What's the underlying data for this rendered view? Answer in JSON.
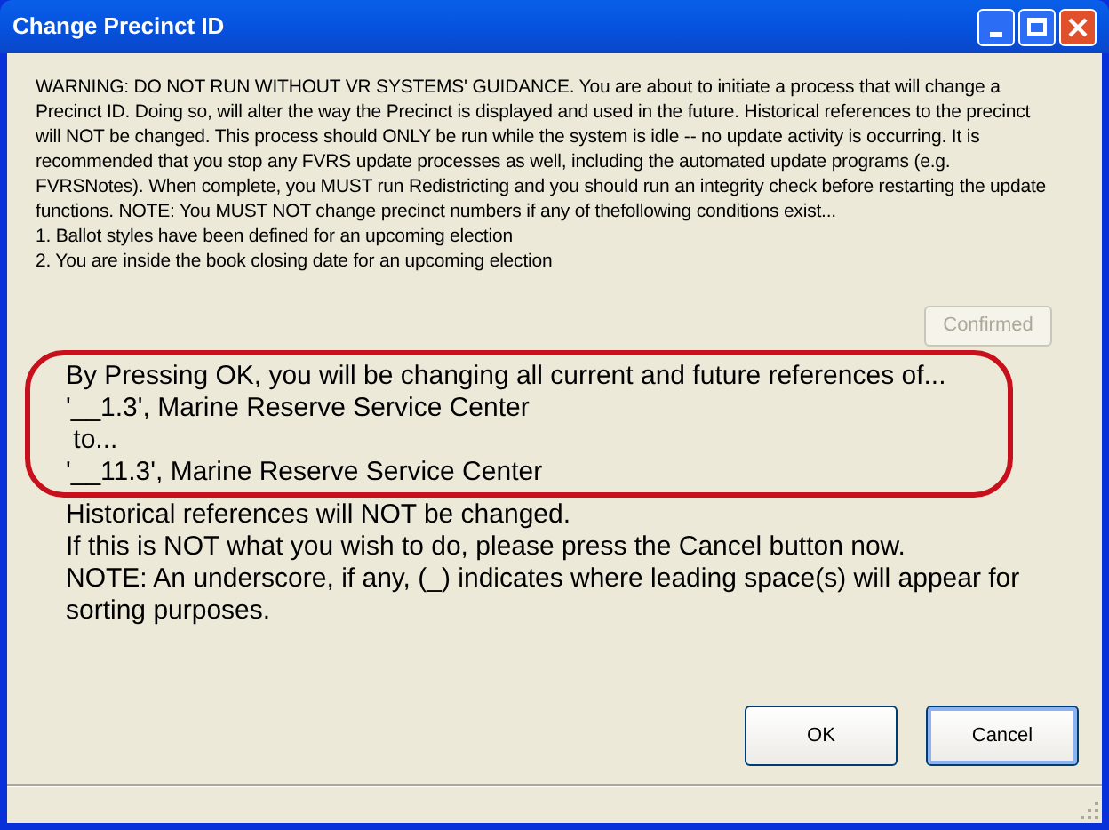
{
  "window": {
    "title": "Change Precinct ID"
  },
  "warning": {
    "paragraph": "WARNING:  DO NOT RUN WITHOUT VR SYSTEMS' GUIDANCE. You are about to initiate a process that will change a Precinct ID.  Doing so, will alter the way the Precinct is displayed and used in the future.  Historical references to the precinct will NOT be changed.  This process should ONLY be run while the system is idle -- no update activity is occurring.  It is recommended that you stop any FVRS update processes as well, including the automated update programs (e.g. FVRSNotes).  When complete, you MUST run Redistricting and you should run an integrity check before restarting the update functions.  NOTE: You MUST NOT change precinct numbers if any of thefollowing conditions exist...",
    "conditions": [
      "1. Ballot styles have been defined for an upcoming election",
      "2. You are inside the book closing date for an upcoming election"
    ]
  },
  "confirmed_button": {
    "label": "Confirmed",
    "disabled": true
  },
  "highlighted_lines": [
    "By Pressing OK, you will be changing all current and future references of...",
    "'__1.3', Marine Reserve Service Center",
    " to...",
    "'__11.3', Marine Reserve Service Center"
  ],
  "message_lines": [
    "Historical references will NOT be changed.",
    "If this is NOT what you wish to do, please press the Cancel button now.",
    "NOTE:  An underscore, if any, (_) indicates where leading space(s) will appear for sorting purposes."
  ],
  "buttons": [
    {
      "label": "OK",
      "selected": false
    },
    {
      "label": "Cancel",
      "selected": true
    }
  ]
}
